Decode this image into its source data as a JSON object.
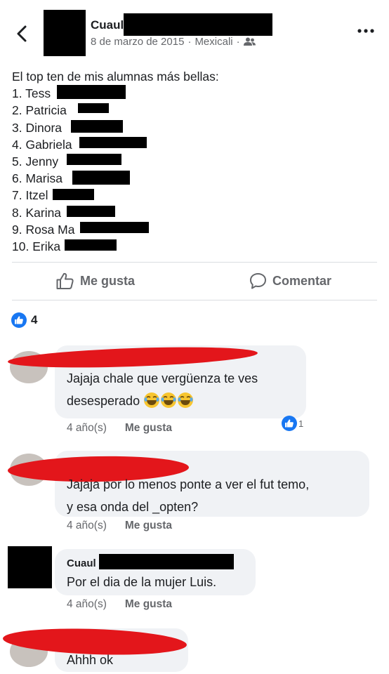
{
  "header": {
    "author_name": "Cuaul",
    "date": "8 de marzo de 2015",
    "separator": "·",
    "location": "Mexicali",
    "audience_icon": "friends-icon",
    "back_icon": "chevron-left-icon",
    "more_icon": "more-horizontal-icon"
  },
  "post": {
    "intro": "El top ten de mis alumnas más bellas:",
    "list": [
      "1. Tess",
      "2.  Patricia",
      "3. Dinora",
      "4. Gabriela",
      "5. Jenny",
      "6. Marisa",
      "7. Itzel",
      "8. Karina",
      "9. Rosa Ma",
      "10. Erika"
    ]
  },
  "actions": {
    "like_label": "Me gusta",
    "comment_label": "Comentar"
  },
  "reactions": {
    "count": "4"
  },
  "comments": [
    {
      "text_lines": [
        "Jajaja chale que vergüenza te ves",
        "desesperado"
      ],
      "emoji": "😂😂😂",
      "time": "4 año(s)",
      "like_label": "Me gusta",
      "reaction_count": "1"
    },
    {
      "text_lines": [
        "Jajaja por lo menos ponte a ver el fut temo,",
        "y esa onda del _opten?"
      ],
      "time": "4 año(s)",
      "like_label": "Me gusta"
    },
    {
      "author": "Cuaul",
      "text_lines": [
        "Por el dia de la mujer Luis."
      ],
      "time": "4 año(s)",
      "like_label": "Me gusta"
    },
    {
      "text_lines": [
        "Ahhh ok"
      ]
    }
  ],
  "colors": {
    "accent": "#1877f2",
    "redaction_red": "#e3161b",
    "bubble": "#f0f2f5",
    "muted": "#65676b"
  }
}
